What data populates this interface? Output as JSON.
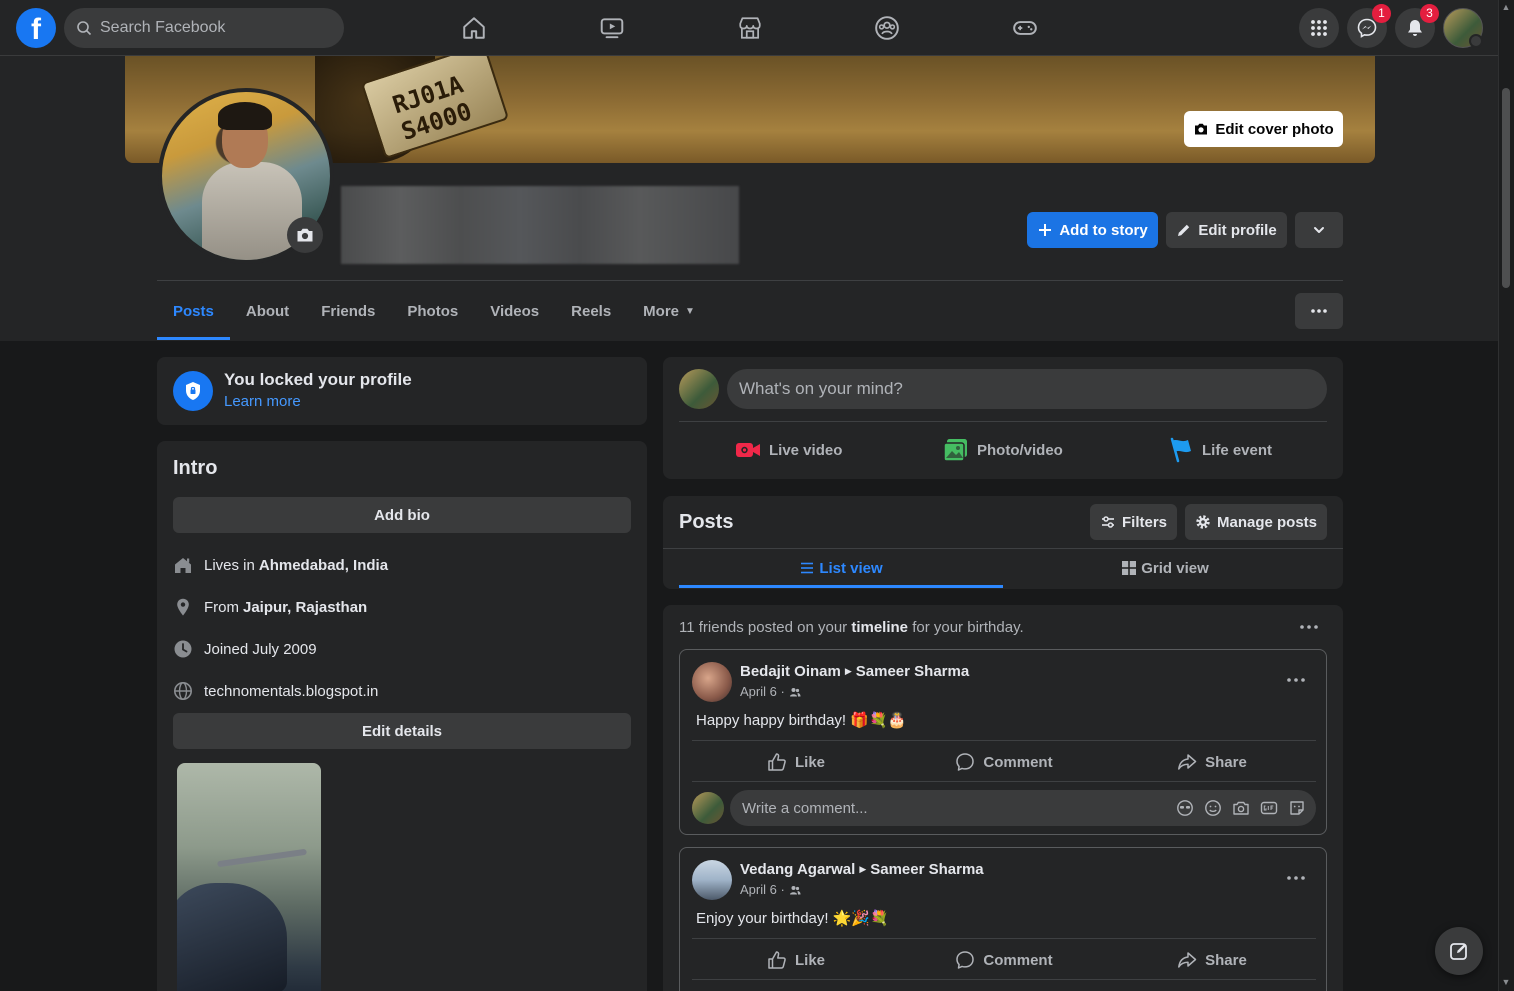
{
  "topbar": {
    "logo": "f",
    "search_placeholder": "Search Facebook",
    "nav_icons": [
      "home-icon",
      "watch-icon",
      "marketplace-icon",
      "groups-icon",
      "gaming-icon"
    ],
    "messenger_badge": "1",
    "notifications_badge": "3"
  },
  "cover": {
    "plate_text": "RJ01A S4000",
    "edit_cover_label": "Edit cover photo"
  },
  "profile": {
    "add_story_label": "Add to story",
    "edit_profile_label": "Edit profile"
  },
  "tabs": [
    {
      "label": "Posts",
      "active": true
    },
    {
      "label": "About"
    },
    {
      "label": "Friends"
    },
    {
      "label": "Photos"
    },
    {
      "label": "Videos"
    },
    {
      "label": "Reels"
    },
    {
      "label": "More"
    }
  ],
  "locked": {
    "title": "You locked your profile",
    "link": "Learn more"
  },
  "intro": {
    "title": "Intro",
    "add_bio": "Add bio",
    "lives_prefix": "Lives in",
    "lives_place": "Ahmedabad, India",
    "from_prefix": "From",
    "from_place": "Jaipur, Rajasthan",
    "joined": "Joined July 2009",
    "website": "technomentals.blogspot.in",
    "edit_details": "Edit details"
  },
  "composer": {
    "placeholder": "What's on your mind?",
    "live_video": "Live video",
    "photo_video": "Photo/video",
    "life_event": "Life event"
  },
  "posts_header": {
    "title": "Posts",
    "filters": "Filters",
    "manage": "Manage posts",
    "list_view": "List view",
    "grid_view": "Grid view"
  },
  "feed": {
    "note_prefix": "11 friends posted on your",
    "note_bold": "timeline",
    "note_suffix": "for your birthday.",
    "posts": [
      {
        "from": "Bedajit Oinam",
        "to": "Sameer Sharma",
        "date": "April 6 ·",
        "message": "Happy happy birthday! 🎁💐🎂"
      },
      {
        "from": "Vedang Agarwal",
        "to": "Sameer Sharma",
        "date": "April 6 ·",
        "message": "Enjoy your birthday! 🌟🎉💐"
      }
    ],
    "like": "Like",
    "comment": "Comment",
    "share": "Share",
    "comment_placeholder": "Write a comment..."
  },
  "colors": {
    "accent": "#2d88ff",
    "brand": "#1877f2",
    "badge": "#e41e3f",
    "background": "#18191a",
    "card": "#242526"
  }
}
